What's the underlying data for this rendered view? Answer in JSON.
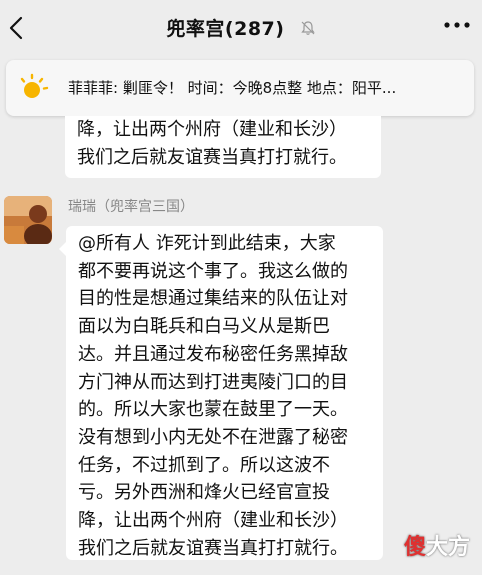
{
  "header": {
    "back_label": "",
    "title": "兜率宫(287)",
    "mute_icon": "bell-off-icon",
    "more_icon": "more-dots-icon"
  },
  "notice": {
    "icon": "sun-icon",
    "text": "菲菲菲: 剿匪令！  时间：今晚8点整 地点：阳平..."
  },
  "previous_message": {
    "lines": [
      "降，让出两个州府（建业和长沙）",
      "我们之后就友谊赛当真打打就行。"
    ]
  },
  "message": {
    "sender": "瑞瑞（兜率宫三国）",
    "lines": [
      "@所有人  诈死计到此结束，大家",
      "都不要再说这个事了。我这么做的",
      "目的性是想通过集结来的队伍让对",
      "面以为白毦兵和白马义从是斯巴",
      "达。并且通过发布秘密任务黑掉敌",
      "方门神从而达到打进夷陵门口的目",
      "的。所以大家也蒙在鼓里了一天。",
      "没有想到小内无处不在泄露了秘密",
      "任务，不过抓到了。所以这波不",
      "亏。另外西洲和烽火已经官宣投",
      "降，让出两个州府（建业和长沙）",
      "我们之后就友谊赛当真打打就行。"
    ]
  },
  "watermark": {
    "part1": "傻",
    "part2": "大方"
  },
  "colors": {
    "background": "#ededed",
    "bubble": "#ffffff",
    "sender": "#888888"
  }
}
